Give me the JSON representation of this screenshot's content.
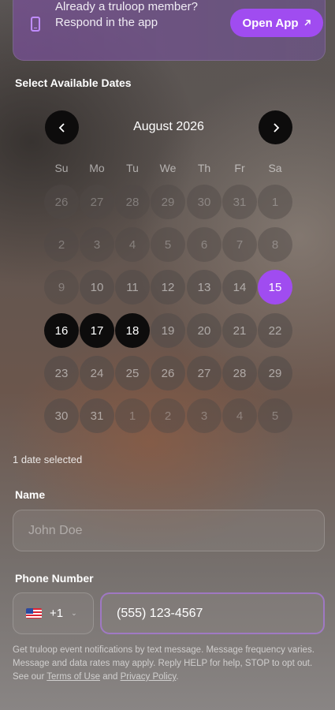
{
  "banner": {
    "text": "Already a truloop member? Respond in the app",
    "button_label": "Open App",
    "button_icon": "arrow-up-right-icon",
    "phone_icon": "phone-icon"
  },
  "calendar": {
    "section_label": "Select Available Dates",
    "month": "August 2026",
    "prev_label": "‹",
    "next_label": "›",
    "weekdays": [
      "Su",
      "Mo",
      "Tu",
      "We",
      "Th",
      "Fr",
      "Sa"
    ],
    "weeks": [
      [
        {
          "d": "26",
          "s": "muted"
        },
        {
          "d": "27",
          "s": "muted"
        },
        {
          "d": "28",
          "s": "muted"
        },
        {
          "d": "29",
          "s": "muted"
        },
        {
          "d": "30",
          "s": "muted"
        },
        {
          "d": "31",
          "s": "muted"
        },
        {
          "d": "1",
          "s": "muted"
        }
      ],
      [
        {
          "d": "2",
          "s": "muted"
        },
        {
          "d": "3",
          "s": "muted"
        },
        {
          "d": "4",
          "s": "muted"
        },
        {
          "d": "5",
          "s": "muted"
        },
        {
          "d": "6",
          "s": "muted"
        },
        {
          "d": "7",
          "s": "muted"
        },
        {
          "d": "8",
          "s": "muted"
        }
      ],
      [
        {
          "d": "9",
          "s": "muted"
        },
        {
          "d": "10",
          "s": "normal"
        },
        {
          "d": "11",
          "s": "normal"
        },
        {
          "d": "12",
          "s": "normal"
        },
        {
          "d": "13",
          "s": "normal"
        },
        {
          "d": "14",
          "s": "normal"
        },
        {
          "d": "15",
          "s": "today"
        }
      ],
      [
        {
          "d": "16",
          "s": "selected"
        },
        {
          "d": "17",
          "s": "selected"
        },
        {
          "d": "18",
          "s": "selected"
        },
        {
          "d": "19",
          "s": "normal"
        },
        {
          "d": "20",
          "s": "normal"
        },
        {
          "d": "21",
          "s": "normal"
        },
        {
          "d": "22",
          "s": "normal"
        }
      ],
      [
        {
          "d": "23",
          "s": "normal"
        },
        {
          "d": "24",
          "s": "normal"
        },
        {
          "d": "25",
          "s": "normal"
        },
        {
          "d": "26",
          "s": "normal"
        },
        {
          "d": "27",
          "s": "normal"
        },
        {
          "d": "28",
          "s": "normal"
        },
        {
          "d": "29",
          "s": "normal"
        }
      ],
      [
        {
          "d": "30",
          "s": "normal"
        },
        {
          "d": "31",
          "s": "normal"
        },
        {
          "d": "1",
          "s": "muted"
        },
        {
          "d": "2",
          "s": "muted"
        },
        {
          "d": "3",
          "s": "muted"
        },
        {
          "d": "4",
          "s": "muted"
        },
        {
          "d": "5",
          "s": "muted"
        }
      ]
    ],
    "selected_count": "1 date selected"
  },
  "form": {
    "name_label": "Name",
    "name_placeholder": "John Doe",
    "phone_label": "Phone Number",
    "country_code": "+1",
    "country_flag": "us-flag-icon",
    "phone_value": "(555) 123-4567",
    "legal_prefix": "Get truloop event notifications by text message. Message frequency varies. Message and data rates may apply. Reply HELP for help, STOP to opt out. See our ",
    "terms_label": "Terms of Use",
    "legal_and": " and ",
    "privacy_label": "Privacy Policy",
    "legal_suffix": "."
  },
  "colors": {
    "accent": "#a04cf0",
    "selected_day": "#0d0c0c"
  }
}
